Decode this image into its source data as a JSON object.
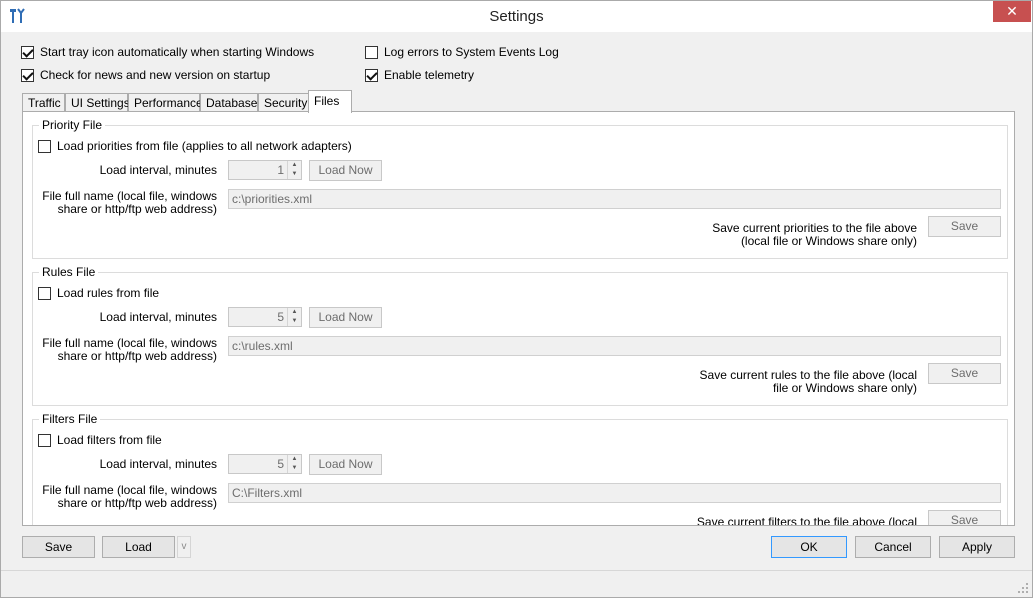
{
  "window": {
    "title": "Settings",
    "close_glyph": "✕"
  },
  "options": {
    "start_tray": {
      "label": "Start tray icon automatically when starting Windows",
      "checked": true
    },
    "check_news": {
      "label": "Check for news and new version on startup",
      "checked": true
    },
    "log_errors": {
      "label": "Log errors to System Events Log",
      "checked": false
    },
    "telemetry": {
      "label": "Enable telemetry",
      "checked": true
    }
  },
  "tabs": [
    {
      "label": "Traffic",
      "active": false
    },
    {
      "label": "UI Settings",
      "active": false
    },
    {
      "label": "Performance",
      "active": false
    },
    {
      "label": "Database",
      "active": false
    },
    {
      "label": "Security",
      "active": false
    },
    {
      "label": "Files",
      "active": true
    }
  ],
  "groups": {
    "priority": {
      "legend": "Priority File",
      "load_checkbox": {
        "label": "Load priorities from file (applies to all network adapters)",
        "checked": false
      },
      "interval_label": "Load interval, minutes",
      "interval_value": "1",
      "load_now": "Load Now",
      "file_label_1": "File full name (local file, windows",
      "file_label_2": "share or http/ftp web address)",
      "file_value": "c:\\priorities.xml",
      "save_label_1": "Save current priorities to the file above",
      "save_label_2": "(local file or Windows share only)",
      "save_button": "Save"
    },
    "rules": {
      "legend": "Rules File",
      "load_checkbox": {
        "label": "Load rules from file",
        "checked": false
      },
      "interval_label": "Load interval, minutes",
      "interval_value": "5",
      "load_now": "Load Now",
      "file_label_1": "File full name (local file, windows",
      "file_label_2": "share or http/ftp web address)",
      "file_value": "c:\\rules.xml",
      "save_label_1": "Save current rules to the file above (local",
      "save_label_2": "file or Windows share only)",
      "save_button": "Save"
    },
    "filters": {
      "legend": "Filters File",
      "load_checkbox": {
        "label": "Load filters from file",
        "checked": false
      },
      "interval_label": "Load interval, minutes",
      "interval_value": "5",
      "load_now": "Load Now",
      "file_label_1": "File full name (local file, windows",
      "file_label_2": "share or http/ftp web address)",
      "file_value": "C:\\Filters.xml",
      "save_label_1": "Save current filters to the file above (local",
      "save_button": "Save"
    }
  },
  "footer": {
    "save": "Save",
    "load": "Load",
    "load_dropdown": "v",
    "ok": "OK",
    "cancel": "Cancel",
    "apply": "Apply"
  }
}
